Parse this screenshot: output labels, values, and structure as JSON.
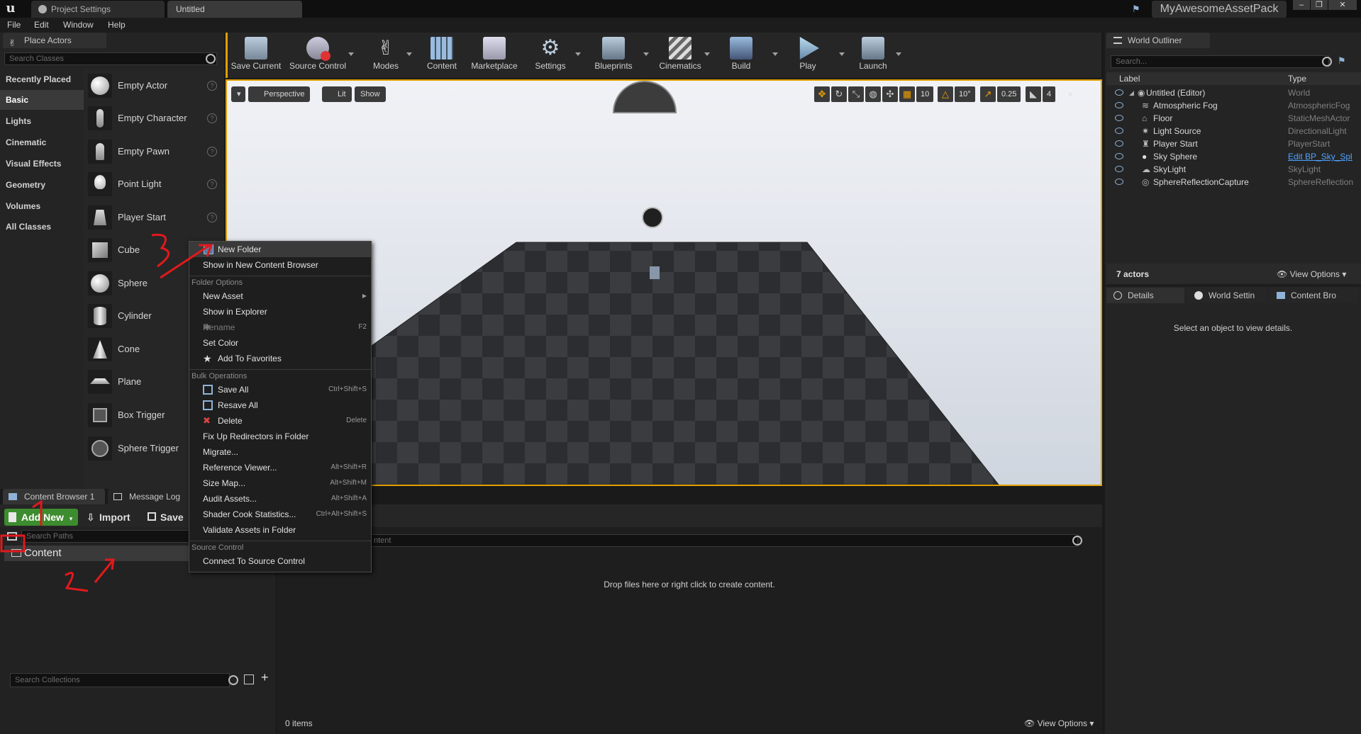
{
  "titlebar": {
    "tabs": [
      {
        "label": "Project Settings"
      },
      {
        "label": "Untitled"
      }
    ],
    "project_name": "MyAwesomeAssetPack"
  },
  "menu": {
    "items": [
      "File",
      "Edit",
      "Window",
      "Help"
    ]
  },
  "place_actors": {
    "tab_label": "Place Actors",
    "search_placeholder": "Search Classes",
    "categories": [
      "Recently Placed",
      "Basic",
      "Lights",
      "Cinematic",
      "Visual Effects",
      "Geometry",
      "Volumes",
      "All Classes"
    ],
    "selected_category": "Basic",
    "actors": [
      "Empty Actor",
      "Empty Character",
      "Empty Pawn",
      "Point Light",
      "Player Start",
      "Cube",
      "Sphere",
      "Cylinder",
      "Cone",
      "Plane",
      "Box Trigger",
      "Sphere Trigger"
    ]
  },
  "toolbar": {
    "buttons": [
      {
        "label": "Save Current",
        "icon": "save-icon"
      },
      {
        "label": "Source Control",
        "icon": "source-control-icon"
      },
      {
        "label": "Modes",
        "icon": "modes-icon"
      },
      {
        "label": "Content",
        "icon": "content-icon"
      },
      {
        "label": "Marketplace",
        "icon": "marketplace-icon"
      },
      {
        "label": "Settings",
        "icon": "settings-icon"
      },
      {
        "label": "Blueprints",
        "icon": "blueprints-icon"
      },
      {
        "label": "Cinematics",
        "icon": "cinematics-icon"
      },
      {
        "label": "Build",
        "icon": "build-icon"
      },
      {
        "label": "Play",
        "icon": "play-icon"
      },
      {
        "label": "Launch",
        "icon": "launch-icon"
      }
    ]
  },
  "viewport": {
    "perspective_label": "Perspective",
    "lit_label": "Lit",
    "show_label": "Show",
    "grid_snap": "10",
    "rotation_snap": "10°",
    "scale_snap": "0.25",
    "camera_speed": "4"
  },
  "context_menu": {
    "items_top": [
      {
        "label": "New Folder",
        "icon": "new-folder-icon"
      },
      {
        "label": "Show in New Content Browser"
      }
    ],
    "folder_options_header": "Folder Options",
    "folder_options": [
      {
        "label": "New Asset",
        "submenu": true
      },
      {
        "label": "Show in Explorer"
      },
      {
        "label": "Rename",
        "shortcut": "F2",
        "disabled": true,
        "icon": "rename-icon"
      },
      {
        "label": "Set Color"
      },
      {
        "label": "Add To Favorites",
        "icon": "star-icon"
      }
    ],
    "bulk_header": "Bulk Operations",
    "bulk_operations": [
      {
        "label": "Save All",
        "shortcut": "Ctrl+Shift+S",
        "icon": "save-all-icon"
      },
      {
        "label": "Resave All",
        "icon": "resave-all-icon"
      },
      {
        "label": "Delete",
        "shortcut": "Delete",
        "icon": "delete-icon"
      },
      {
        "label": "Fix Up Redirectors in Folder"
      },
      {
        "label": "Migrate..."
      },
      {
        "label": "Reference Viewer...",
        "shortcut": "Alt+Shift+R"
      },
      {
        "label": "Size Map...",
        "shortcut": "Alt+Shift+M"
      },
      {
        "label": "Audit Assets...",
        "shortcut": "Alt+Shift+A"
      },
      {
        "label": "Shader Cook Statistics...",
        "shortcut": "Ctrl+Alt+Shift+S"
      },
      {
        "label": "Validate Assets in Folder"
      }
    ],
    "source_control_header": "Source Control",
    "source_control": [
      {
        "label": "Connect To Source Control"
      }
    ]
  },
  "content_browser": {
    "tabs": [
      {
        "label": "Content Browser 1"
      },
      {
        "label": "Message Log"
      }
    ],
    "add_new_label": "Add New",
    "import_label": "Import",
    "save_label": "Save",
    "search_paths_placeholder": "Search Paths",
    "search_content_placeholder": "ntent",
    "tree_root": "Content",
    "search_collections_placeholder": "Search Collections",
    "empty_message": "Drop files here or right click to create content.",
    "item_count": "0 items",
    "view_options_label": "View Options"
  },
  "outliner": {
    "tab_label": "World Outliner",
    "search_placeholder": "Search...",
    "col_label": "Label",
    "col_type": "Type",
    "rows": [
      {
        "label": "Untitled (Editor)",
        "type": "World"
      },
      {
        "label": "Atmospheric Fog",
        "type": "AtmosphericFog"
      },
      {
        "label": "Floor",
        "type": "StaticMeshActor"
      },
      {
        "label": "Light Source",
        "type": "DirectionalLight"
      },
      {
        "label": "Player Start",
        "type": "PlayerStart"
      },
      {
        "label": "Sky Sphere",
        "type": "Edit BP_Sky_Spl"
      },
      {
        "label": "SkyLight",
        "type": "SkyLight"
      },
      {
        "label": "SphereReflectionCapture",
        "type": "SphereReflection"
      }
    ],
    "actor_count": "7 actors",
    "view_options_label": "View Options"
  },
  "details": {
    "tabs": [
      {
        "label": "Details"
      },
      {
        "label": "World Settin"
      },
      {
        "label": "Content Bro"
      }
    ],
    "empty_message": "Select an object to view details."
  },
  "colors": {
    "accent_orange": "#e0a000",
    "add_new_green": "#3d8c2f",
    "annotation_red": "#e0191c",
    "link_blue": "#4fa3ff"
  }
}
